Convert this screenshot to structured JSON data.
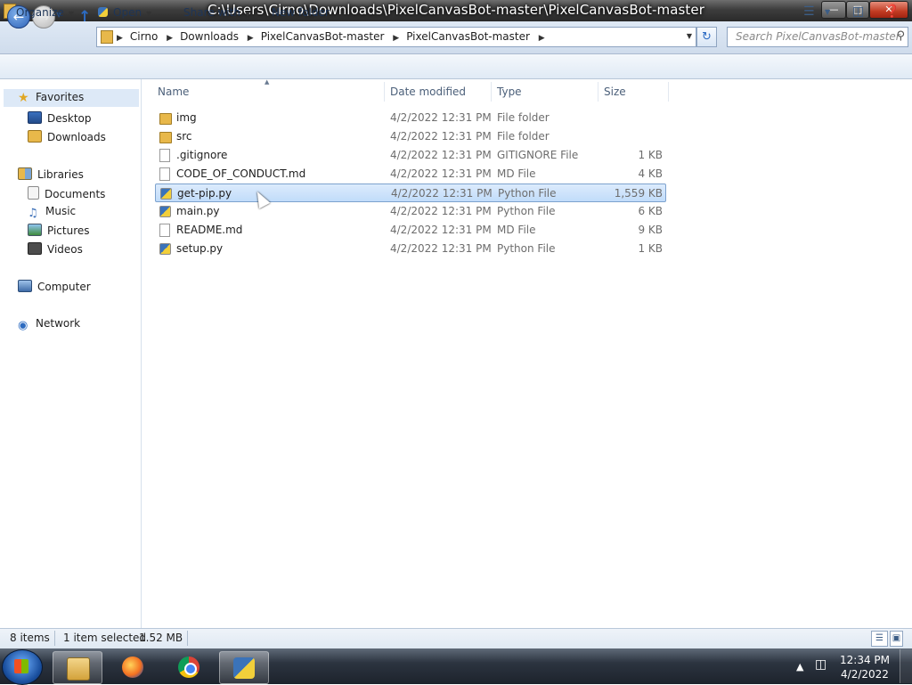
{
  "window": {
    "title": "C:\\Users\\Cirno\\Downloads\\PixelCanvasBot-master\\PixelCanvasBot-master"
  },
  "address": {
    "crumbs": [
      "Cirno",
      "Downloads",
      "PixelCanvasBot-master",
      "PixelCanvasBot-master"
    ]
  },
  "search": {
    "placeholder": "Search PixelCanvasBot-master"
  },
  "toolbar": {
    "organize": "Organize",
    "open": "Open",
    "share_with": "Share with",
    "new_folder": "New folder"
  },
  "sidebar": {
    "favorites": "Favorites",
    "desktop": "Desktop",
    "downloads": "Downloads",
    "libraries": "Libraries",
    "documents": "Documents",
    "music": "Music",
    "pictures": "Pictures",
    "videos": "Videos",
    "computer": "Computer",
    "network": "Network"
  },
  "columns": {
    "name": "Name",
    "date": "Date modified",
    "type": "Type",
    "size": "Size"
  },
  "files": [
    {
      "name": "img",
      "date": "4/2/2022 12:31 PM",
      "type": "File folder",
      "size": "",
      "icon": "folder-icon"
    },
    {
      "name": "src",
      "date": "4/2/2022 12:31 PM",
      "type": "File folder",
      "size": "",
      "icon": "folder-icon"
    },
    {
      "name": ".gitignore",
      "date": "4/2/2022 12:31 PM",
      "type": "GITIGNORE File",
      "size": "1 KB",
      "icon": "file-icon"
    },
    {
      "name": "CODE_OF_CONDUCT.md",
      "date": "4/2/2022 12:31 PM",
      "type": "MD File",
      "size": "4 KB",
      "icon": "file-icon"
    },
    {
      "name": "get-pip.py",
      "date": "4/2/2022 12:31 PM",
      "type": "Python File",
      "size": "1,559 KB",
      "icon": "python-file-icon",
      "selected": true
    },
    {
      "name": "main.py",
      "date": "4/2/2022 12:31 PM",
      "type": "Python File",
      "size": "6 KB",
      "icon": "python-file-icon"
    },
    {
      "name": "README.md",
      "date": "4/2/2022 12:31 PM",
      "type": "MD File",
      "size": "9 KB",
      "icon": "file-icon"
    },
    {
      "name": "setup.py",
      "date": "4/2/2022 12:31 PM",
      "type": "Python File",
      "size": "1 KB",
      "icon": "python-file-icon"
    }
  ],
  "status": {
    "items": "8 items",
    "selected": "1 item selected",
    "size": "1.52 MB"
  },
  "taskbar": {
    "apps": [
      "windows-explorer-icon",
      "firefox-icon",
      "chrome-icon",
      "python-icon"
    ],
    "time": "12:34 PM",
    "date": "4/2/2022"
  }
}
